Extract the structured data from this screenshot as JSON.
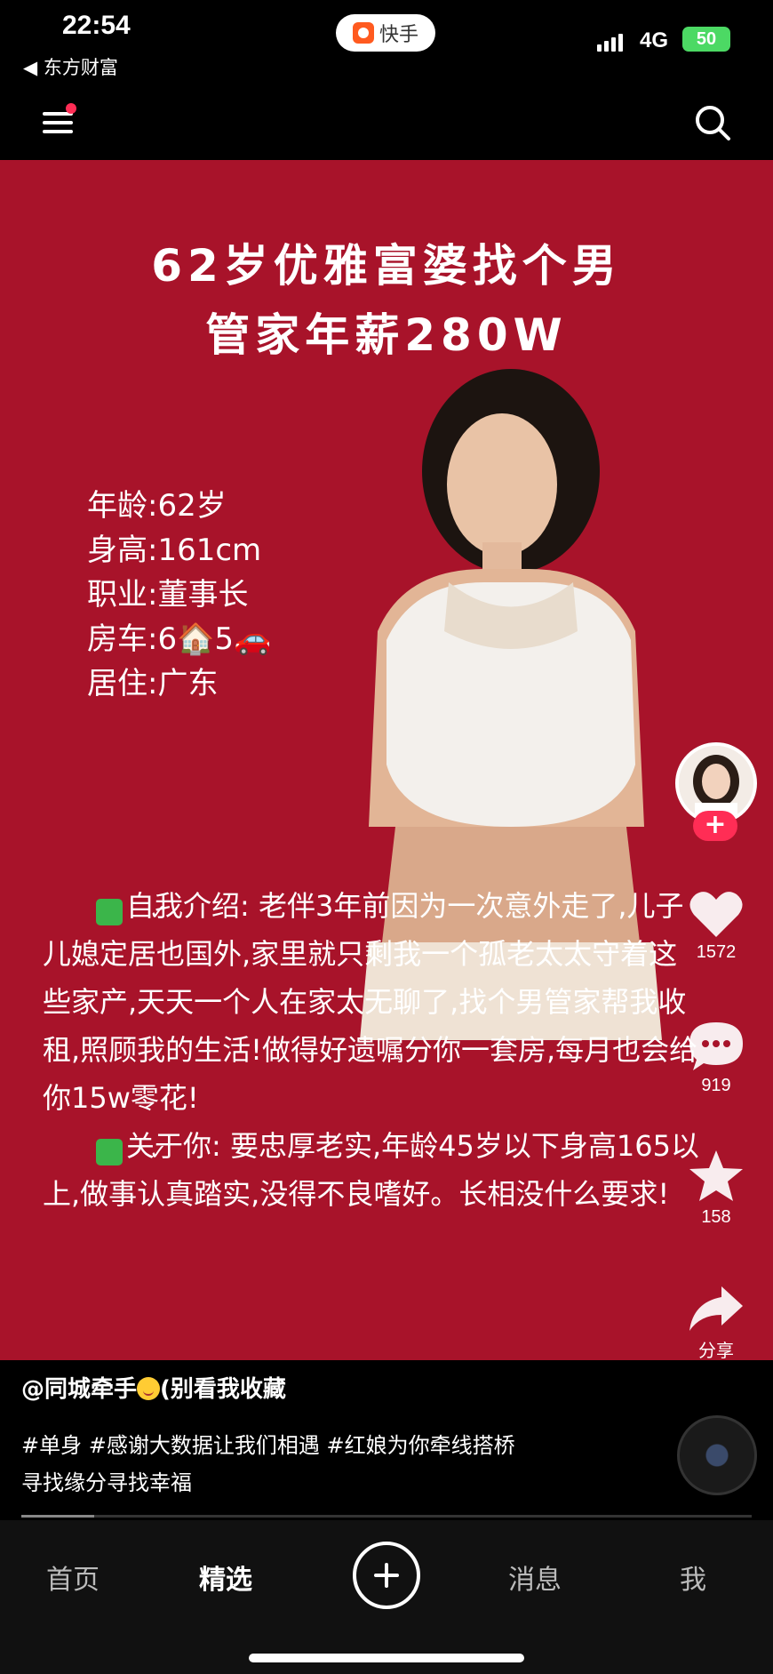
{
  "status_bar": {
    "time": "22:54",
    "back_app": "◀ 东方财富",
    "app_name": "快手",
    "network": "4G",
    "battery": "50"
  },
  "icons": {
    "menu": "menu-icon",
    "search": "search-icon",
    "like": "heart-icon",
    "comment": "comment-icon",
    "favorite": "star-icon",
    "share": "share-icon"
  },
  "colors": {
    "card_bg": "#a8132a",
    "accent": "#ff2d55",
    "check_green": "#3bb54a"
  },
  "post": {
    "title_line1": "62岁优雅富婆找个男",
    "title_line2": "管家年薪280W",
    "info": [
      {
        "label": "年龄",
        "value": ":62岁"
      },
      {
        "label": "身高",
        "value": ":161cm"
      },
      {
        "label": "职业",
        "value": ":董事长"
      },
      {
        "label": "房车",
        "value": ":6🏠5🚗"
      },
      {
        "label": "居住",
        "value": ":广东"
      }
    ],
    "intro_self": "自我介绍: 老伴3年前因为一次意外走了,儿子儿媳定居也国外,家里就只剩我一个孤老太太守着这些家产,天天一个人在家太无聊了,找个男管家帮我收租,照顾我的生活!做得好遗嘱分你一套房,每月也会给你15w零花!",
    "intro_you": "关于你: 要忠厚老实,年龄45岁以下身高165以上,做事认真踏实,没得不良嗜好。长相没什么要求!"
  },
  "actions": {
    "follow": "+",
    "likes": "1572",
    "comments": "919",
    "favorites": "158",
    "share": "分享"
  },
  "caption": {
    "author_prefix": "@同城牵手",
    "author_suffix": "(别看我收藏",
    "tags_line1": "#单身 #感谢大数据让我们相遇 #红娘为你牵线搭桥",
    "tags_line2": "寻找缘分寻找幸福",
    "progress": 0.1
  },
  "tabs": {
    "home": "首页",
    "featured": "精选",
    "messages": "消息",
    "me": "我"
  }
}
